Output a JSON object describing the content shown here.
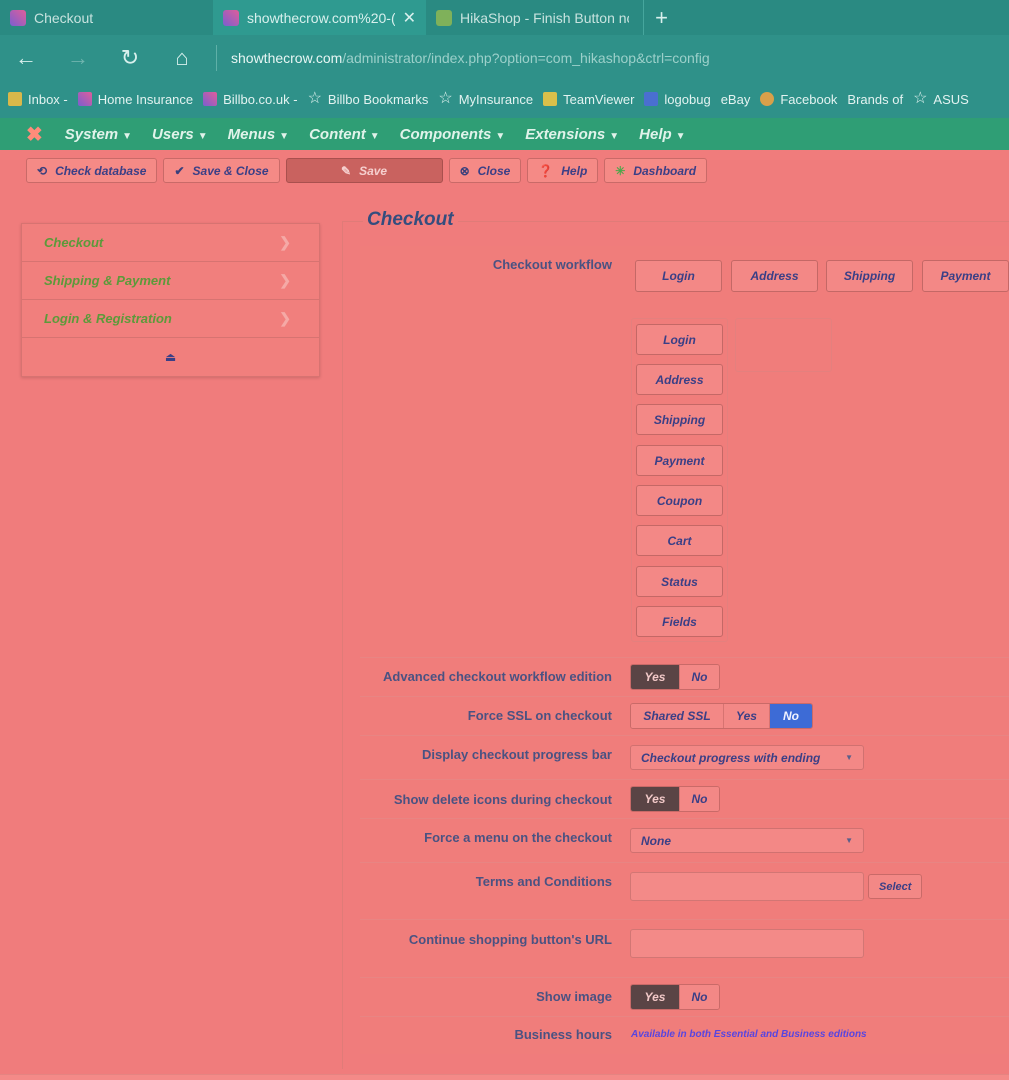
{
  "browser": {
    "tabs": [
      {
        "title": "Checkout",
        "icon": "joomla-cross-icon",
        "active": false
      },
      {
        "title": "showthecrow.com%20-⁠(",
        "icon": "joomla-cross-icon",
        "active": true,
        "close": "✕"
      },
      {
        "title": "HikaShop - Finish Button nc",
        "icon": "hikashop-leaf-icon",
        "active": false
      }
    ],
    "new_tab": "+",
    "url_host": "showthecrow.com",
    "url_path": "/administrator/index.php?option=com_hikashop&ctrl=config",
    "bookmarks": [
      {
        "label": "Inbox -",
        "icon": "mail-icon",
        "color": "#d9b84a"
      },
      {
        "label": "Home Insurance",
        "icon": "joomla-cross-icon",
        "color": "#7a5fd0"
      },
      {
        "label": "Billbo.co.uk -",
        "icon": "joomla-cross-icon",
        "color": "#7a5fd0"
      },
      {
        "label": "Billbo Bookmarks",
        "icon": "star-icon"
      },
      {
        "label": "MyInsurance",
        "icon": "star-icon"
      },
      {
        "label": "TeamViewer",
        "icon": "folder-icon",
        "color": "#d9c04a"
      },
      {
        "label": "logobug",
        "icon": "logobug-icon",
        "color": "#4a6fd0"
      },
      {
        "label": "eBay",
        "icon": "none"
      },
      {
        "label": "Facebook",
        "icon": "globe-icon",
        "color": "#d9a04a"
      },
      {
        "label": "Brands of",
        "icon": "none"
      },
      {
        "label": "ASUS",
        "icon": "star-icon"
      }
    ]
  },
  "joomla_menu": [
    "System",
    "Users",
    "Menus",
    "Content",
    "Components",
    "Extensions",
    "Help"
  ],
  "toolbar": {
    "check_database": "Check database",
    "save_close": "Save & Close",
    "save": "Save",
    "close": "Close",
    "help": "Help",
    "dashboard": "Dashboard"
  },
  "sidebar": {
    "items": [
      "Checkout",
      "Shipping & Payment",
      "Login & Registration"
    ]
  },
  "section_title": "Checkout",
  "form": {
    "checkout_workflow_label": "Checkout workflow",
    "workflow_top": [
      "Login",
      "Address",
      "Shipping",
      "Payment"
    ],
    "workflow_column": [
      "Login",
      "Address",
      "Shipping",
      "Payment",
      "Coupon",
      "Cart",
      "Status",
      "Fields"
    ],
    "advanced_label": "Advanced checkout workflow edition",
    "advanced_options": [
      "Yes",
      "No"
    ],
    "advanced_selected": "Yes",
    "force_ssl_label": "Force SSL on checkout",
    "force_ssl_options": [
      "Shared SSL",
      "Yes",
      "No"
    ],
    "force_ssl_selected": "No",
    "progress_label": "Display checkout progress bar",
    "progress_value": "Checkout progress with ending",
    "delete_icons_label": "Show delete icons during checkout",
    "delete_icons_options": [
      "Yes",
      "No"
    ],
    "delete_icons_selected": "Yes",
    "force_menu_label": "Force a menu on the checkout",
    "force_menu_value": "None",
    "terms_label": "Terms and Conditions",
    "terms_value": "",
    "select_button": "Select",
    "continue_url_label": "Continue shopping button's URL",
    "continue_url_value": "",
    "show_image_label": "Show image",
    "show_image_options": [
      "Yes",
      "No"
    ],
    "show_image_selected": "Yes",
    "business_hours_label": "Business hours",
    "business_hours_note": "Available in both Essential and Business editions"
  }
}
